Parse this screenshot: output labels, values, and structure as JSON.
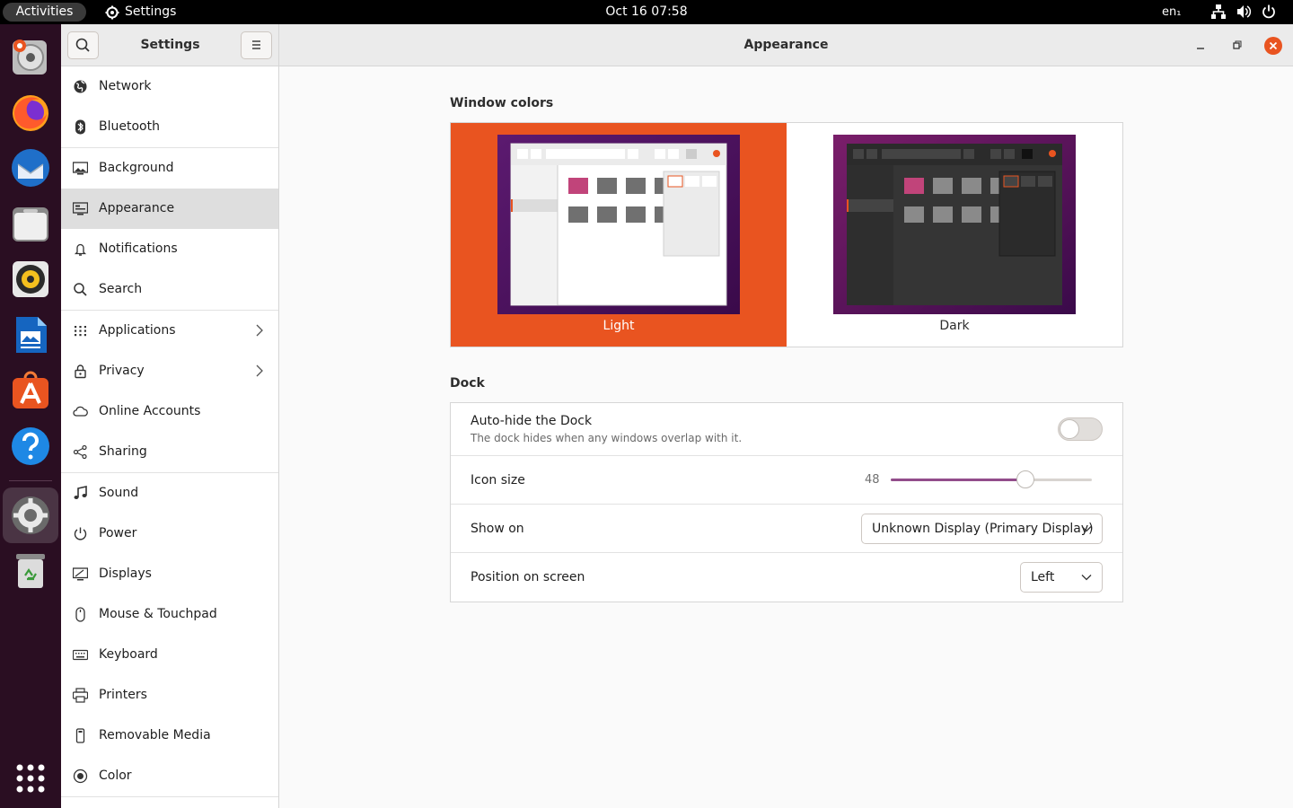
{
  "topbar": {
    "activities": "Activities",
    "app_name": "Settings",
    "clock": "Oct 16  07:58",
    "language": "en₁"
  },
  "dock": {
    "items": [
      "Chromium Web Browser",
      "Firefox Web Browser",
      "Thunderbird Mail",
      "Files",
      "Rhythmbox",
      "LibreOffice Writer",
      "Ubuntu Software",
      "Help",
      "Settings",
      "Trash"
    ],
    "show_apps": "Show Applications"
  },
  "sidebar": {
    "title": "Settings",
    "items": [
      {
        "label": "Network"
      },
      {
        "label": "Bluetooth"
      },
      {
        "label": "Background"
      },
      {
        "label": "Appearance"
      },
      {
        "label": "Notifications"
      },
      {
        "label": "Search"
      },
      {
        "label": "Applications"
      },
      {
        "label": "Privacy"
      },
      {
        "label": "Online Accounts"
      },
      {
        "label": "Sharing"
      },
      {
        "label": "Sound"
      },
      {
        "label": "Power"
      },
      {
        "label": "Displays"
      },
      {
        "label": "Mouse & Touchpad"
      },
      {
        "label": "Keyboard"
      },
      {
        "label": "Printers"
      },
      {
        "label": "Removable Media"
      },
      {
        "label": "Color"
      }
    ],
    "selected": "Appearance"
  },
  "header": {
    "title": "Appearance"
  },
  "window_colors": {
    "title": "Window colors",
    "light_label": "Light",
    "dark_label": "Dark",
    "selected": "Light",
    "accent_color": "#e95420"
  },
  "dock_settings": {
    "title": "Dock",
    "autohide_label": "Auto-hide the Dock",
    "autohide_sub": "The dock hides when any windows overlap with it.",
    "autohide_enabled": false,
    "icon_size_label": "Icon size",
    "icon_size_value": "48",
    "icon_size_fraction": 0.67,
    "show_on_label": "Show on",
    "show_on_value": "Unknown Display (Primary Display)",
    "position_label": "Position on screen",
    "position_value": "Left"
  }
}
